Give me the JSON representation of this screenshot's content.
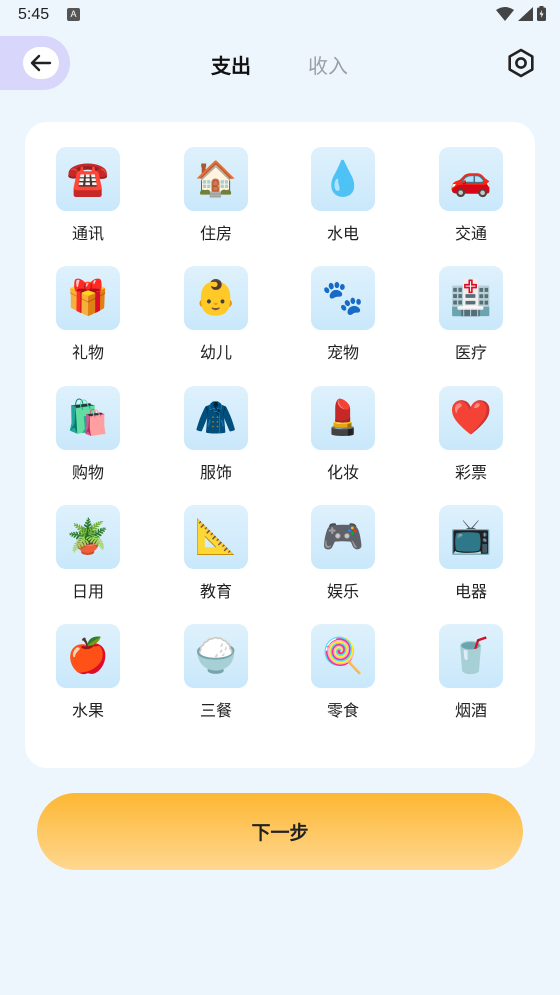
{
  "status_bar": {
    "time": "5:45",
    "notif_badge": "A"
  },
  "header": {
    "tabs": [
      {
        "label": "支出",
        "active": true
      },
      {
        "label": "收入",
        "active": false
      }
    ]
  },
  "categories": [
    {
      "label": "通讯",
      "emoji": "☎️",
      "icon": "telephone-icon"
    },
    {
      "label": "住房",
      "emoji": "🏠",
      "icon": "house-icon"
    },
    {
      "label": "水电",
      "emoji": "💧",
      "icon": "water-drop-icon"
    },
    {
      "label": "交通",
      "emoji": "🚗",
      "icon": "car-icon"
    },
    {
      "label": "礼物",
      "emoji": "🎁",
      "icon": "gift-icon"
    },
    {
      "label": "幼儿",
      "emoji": "👶",
      "icon": "baby-icon"
    },
    {
      "label": "宠物",
      "emoji": "🐾",
      "icon": "paw-icon"
    },
    {
      "label": "医疗",
      "emoji": "🏥",
      "icon": "hospital-icon"
    },
    {
      "label": "购物",
      "emoji": "🛍️",
      "icon": "shopping-bags-icon"
    },
    {
      "label": "服饰",
      "emoji": "🧥",
      "icon": "coat-icon"
    },
    {
      "label": "化妆",
      "emoji": "💄",
      "icon": "lipstick-icon"
    },
    {
      "label": "彩票",
      "emoji": "❤️",
      "icon": "heart-icon"
    },
    {
      "label": "日用",
      "emoji": "🪴",
      "icon": "potted-plant-icon"
    },
    {
      "label": "教育",
      "emoji": "📐",
      "icon": "triangle-ruler-icon"
    },
    {
      "label": "娱乐",
      "emoji": "🎮",
      "icon": "game-controller-icon"
    },
    {
      "label": "电器",
      "emoji": "📺",
      "icon": "television-icon"
    },
    {
      "label": "水果",
      "emoji": "🍎",
      "icon": "apple-icon"
    },
    {
      "label": "三餐",
      "emoji": "🍚",
      "icon": "rice-bowl-icon"
    },
    {
      "label": "零食",
      "emoji": "🍭",
      "icon": "lollipop-icon"
    },
    {
      "label": "烟酒",
      "emoji": "🥤",
      "icon": "drink-cup-icon"
    }
  ],
  "next_button": {
    "label": "下一步"
  }
}
